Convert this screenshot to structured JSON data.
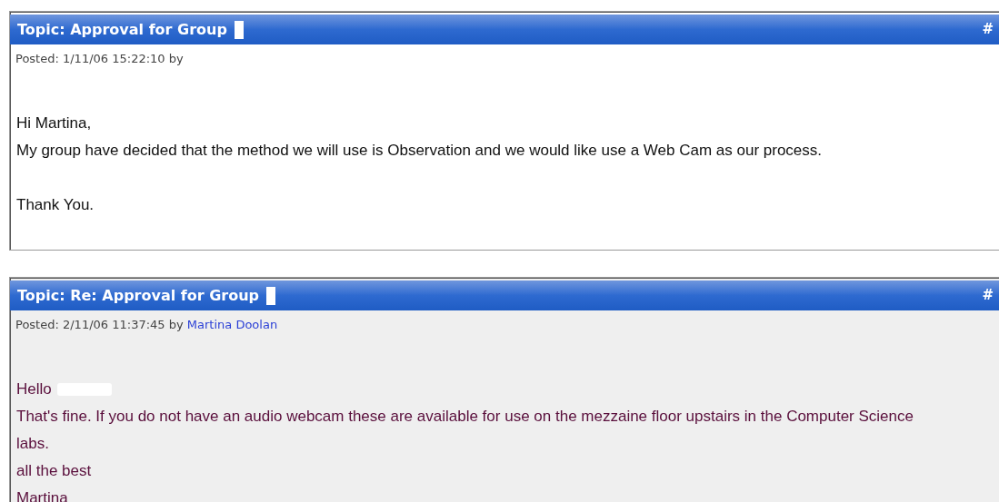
{
  "posts": [
    {
      "topic": "Topic: Approval for Group",
      "corner": "#",
      "redacted_title": true,
      "posted": "Posted: 1/11/06 15:22:10 by",
      "shaded": false,
      "paragraphs": [
        {
          "lines": [
            {
              "text": "Hi Martina,"
            },
            {
              "text": "My group have decided that the method we will use is Observation and we would like use a Web Cam as our process."
            }
          ]
        },
        {
          "lines": [
            {
              "text": "Thank You."
            }
          ]
        }
      ]
    },
    {
      "topic": "Topic: Re: Approval for Group",
      "corner": "#",
      "redacted_title": true,
      "posted": "Posted: 2/11/06 11:37:45 by",
      "author": "Martina Doolan",
      "shaded": true,
      "paragraphs": [
        {
          "lines": [
            {
              "text": "Hello",
              "redacted": true
            },
            {
              "text": "That's fine. If you do not have an audio webcam these are available for use on the mezzaine floor upstairs in the Computer Science"
            },
            {
              "text": "labs."
            },
            {
              "text": "all the best"
            },
            {
              "text": "Martina"
            }
          ]
        }
      ]
    }
  ]
}
